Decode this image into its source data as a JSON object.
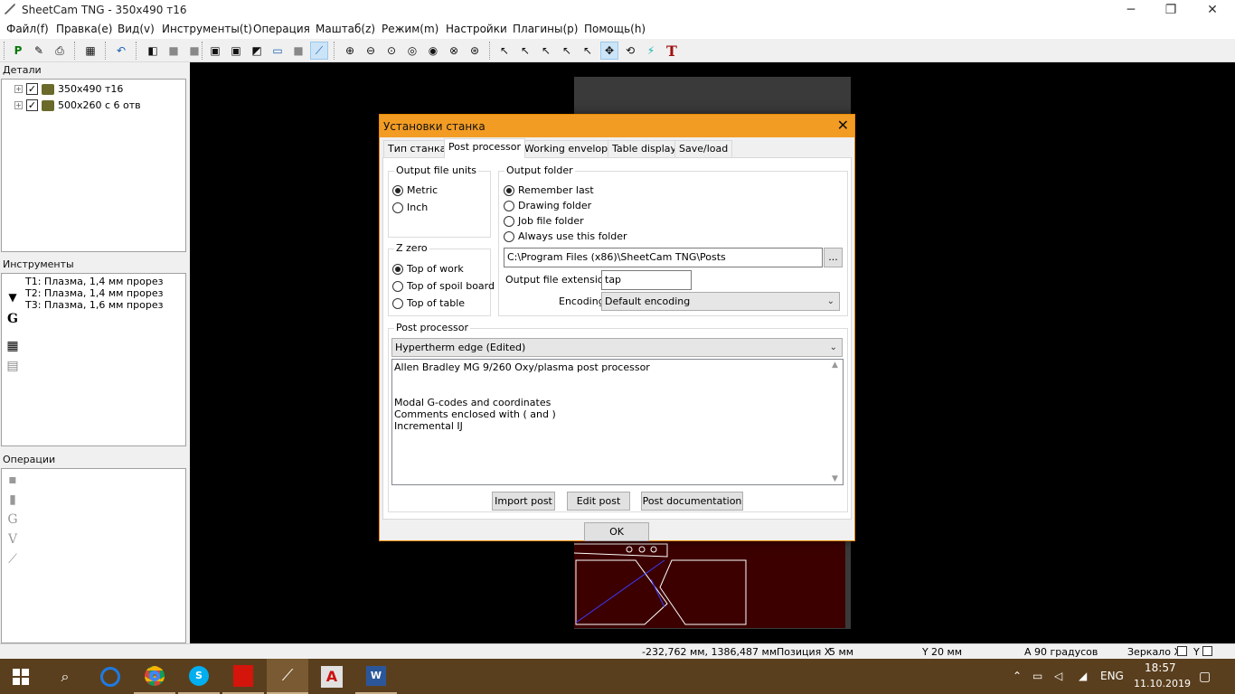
{
  "window": {
    "title": "SheetCam TNG - 350x490 т16",
    "controls": {
      "minimize": "─",
      "restore": "❐",
      "close": "✕"
    }
  },
  "menu": [
    "Файл(f)",
    "Правка(e)",
    "Вид(v)",
    "Инструменты(t)",
    "Операция",
    "Маштаб(z)",
    "Режим(m)",
    "Настройки",
    "Плагины(p)",
    "Помощь(h)"
  ],
  "panels": {
    "parts": {
      "title": "Детали",
      "items": [
        {
          "label": "350x490 т16",
          "checked": "✓"
        },
        {
          "label": "500x260 с 6 отв",
          "checked": "✓"
        }
      ]
    },
    "tools": {
      "title": "Инструменты",
      "items": [
        "T1: Плазма, 1,4 мм прорез",
        "T2: Плазма, 1,4 мм прорез",
        "T3: Плазма, 1,6 мм прорез"
      ]
    },
    "operations": {
      "title": "Операции"
    }
  },
  "dialog": {
    "title": "Установки станка",
    "close": "✕",
    "tabs": [
      "Тип станка",
      "Post processor",
      "Working envelope",
      "Table display",
      "Save/load"
    ],
    "selected_tab": "Post processor",
    "output_units": {
      "title": "Output file units",
      "options": [
        "Metric",
        "Inch"
      ],
      "selected": "Metric"
    },
    "z_zero": {
      "title": "Z zero",
      "options": [
        "Top of work",
        "Top of spoil board",
        "Top of table"
      ],
      "selected": "Top of work"
    },
    "output_folder": {
      "title": "Output folder",
      "options": [
        "Remember last",
        "Drawing folder",
        "Job file folder",
        "Always use this folder"
      ],
      "selected": "Remember last",
      "path": "C:\\Program Files (x86)\\SheetCam TNG\\Posts",
      "browse": "...",
      "ext_label": "Output file extension",
      "ext_value": "tap",
      "encoding_label": "Encoding",
      "encoding_value": "Default encoding"
    },
    "post": {
      "title": "Post processor",
      "selected": "Hypertherm edge (Edited)",
      "description": [
        "Allen Bradley MG 9/260 Oxy/plasma post processor",
        "",
        "",
        "Modal G-codes and coordinates",
        "Comments enclosed with ( and )",
        "Incremental IJ"
      ],
      "buttons": {
        "import": "Import post",
        "edit": "Edit post",
        "doc": "Post documentation"
      }
    },
    "ok": "OK"
  },
  "status": {
    "coords": "-232,762 мм, 1386,487 мм",
    "pos_x_label": "Позиция X",
    "pos_x": "5 мм",
    "y_label": "Y",
    "y_value": "20 мм",
    "a_label": "A",
    "a_value": "90 градусов",
    "mirror_label": "Зеркало X",
    "mirror_y": "Y"
  },
  "taskbar": {
    "lang": "ENG",
    "time": "18:57",
    "date": "11.10.2019"
  },
  "colors": {
    "dialog_title": "#f39c24",
    "canvas": "#000000",
    "part_fill": "#3c0000",
    "taskbar": "#5a3f1e"
  }
}
